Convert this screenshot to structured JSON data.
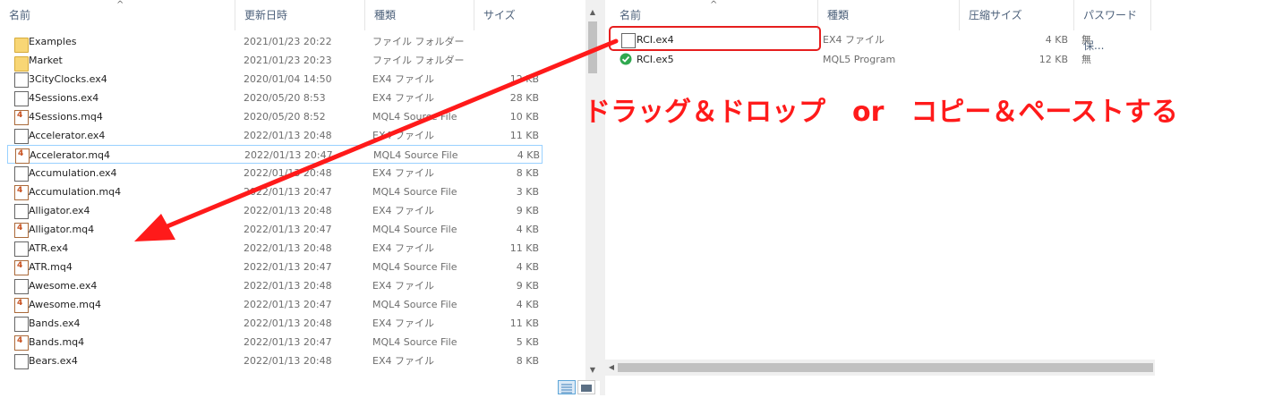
{
  "left_pane": {
    "headers": {
      "name": "名前",
      "modified": "更新日時",
      "type": "種類",
      "size": "サイズ"
    },
    "files": [
      {
        "name": "Examples",
        "modified": "2021/01/23 20:22",
        "type": "ファイル フォルダー",
        "size": "",
        "icon": "folder-icon"
      },
      {
        "name": "Market",
        "modified": "2021/01/23 20:23",
        "type": "ファイル フォルダー",
        "size": "",
        "icon": "folder-icon"
      },
      {
        "name": "3CityClocks.ex4",
        "modified": "2020/01/04 14:50",
        "type": "EX4 ファイル",
        "size": "12 KB",
        "icon": "file-icon"
      },
      {
        "name": "4Sessions.ex4",
        "modified": "2020/05/20 8:53",
        "type": "EX4 ファイル",
        "size": "28 KB",
        "icon": "file-icon"
      },
      {
        "name": "4Sessions.mq4",
        "modified": "2020/05/20 8:52",
        "type": "MQL4 Source File",
        "size": "10 KB",
        "icon": "mq4-icon"
      },
      {
        "name": "Accelerator.ex4",
        "modified": "2022/01/13 20:48",
        "type": "EX4 ファイル",
        "size": "11 KB",
        "icon": "file-icon"
      },
      {
        "name": "Accelerator.mq4",
        "modified": "2022/01/13 20:47",
        "type": "MQL4 Source File",
        "size": "4 KB",
        "icon": "mq4-icon"
      },
      {
        "name": "Accumulation.ex4",
        "modified": "2022/01/13 20:48",
        "type": "EX4 ファイル",
        "size": "8 KB",
        "icon": "file-icon"
      },
      {
        "name": "Accumulation.mq4",
        "modified": "2022/01/13 20:47",
        "type": "MQL4 Source File",
        "size": "3 KB",
        "icon": "mq4-icon"
      },
      {
        "name": "Alligator.ex4",
        "modified": "2022/01/13 20:48",
        "type": "EX4 ファイル",
        "size": "9 KB",
        "icon": "file-icon"
      },
      {
        "name": "Alligator.mq4",
        "modified": "2022/01/13 20:47",
        "type": "MQL4 Source File",
        "size": "4 KB",
        "icon": "mq4-icon"
      },
      {
        "name": "ATR.ex4",
        "modified": "2022/01/13 20:48",
        "type": "EX4 ファイル",
        "size": "11 KB",
        "icon": "file-icon"
      },
      {
        "name": "ATR.mq4",
        "modified": "2022/01/13 20:47",
        "type": "MQL4 Source File",
        "size": "4 KB",
        "icon": "mq4-icon"
      },
      {
        "name": "Awesome.ex4",
        "modified": "2022/01/13 20:48",
        "type": "EX4 ファイル",
        "size": "9 KB",
        "icon": "file-icon"
      },
      {
        "name": "Awesome.mq4",
        "modified": "2022/01/13 20:47",
        "type": "MQL4 Source File",
        "size": "4 KB",
        "icon": "mq4-icon"
      },
      {
        "name": "Bands.ex4",
        "modified": "2022/01/13 20:48",
        "type": "EX4 ファイル",
        "size": "11 KB",
        "icon": "file-icon"
      },
      {
        "name": "Bands.mq4",
        "modified": "2022/01/13 20:47",
        "type": "MQL4 Source File",
        "size": "5 KB",
        "icon": "mq4-icon"
      },
      {
        "name": "Bears.ex4",
        "modified": "2022/01/13 20:48",
        "type": "EX4 ファイル",
        "size": "8 KB",
        "icon": "file-icon"
      }
    ]
  },
  "right_pane": {
    "headers": {
      "name": "名前",
      "type": "種類",
      "compressed": "圧縮サイズ",
      "password": "パスワード保..."
    },
    "files": [
      {
        "name": "RCI.ex4",
        "type": "EX4 ファイル",
        "compressed": "4 KB",
        "password": "無",
        "icon": "file-icon"
      },
      {
        "name": "RCI.ex5",
        "type": "MQL5 Program",
        "compressed": "12 KB",
        "password": "無",
        "icon": "mql5-icon"
      }
    ]
  },
  "annotation": {
    "text": "ドラッグ＆ドロップ　or　コピー＆ペーストする",
    "color": "#ff1a1a"
  },
  "colors": {
    "accent": "#ff1a1a",
    "selection": "#99d1ff",
    "header_text": "#4c607a"
  }
}
